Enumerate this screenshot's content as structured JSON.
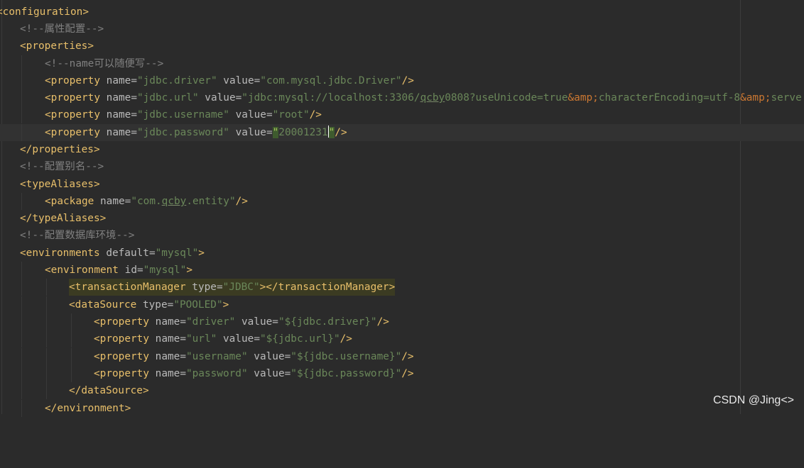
{
  "watermark": "CSDN @Jing<>",
  "lines": {
    "l1_tag": "configuration",
    "l2_cmt": "<!--属性配置-->",
    "l3_tag": "properties",
    "l4_cmt": "<!--name可以随便写-->",
    "p_tag": "property",
    "name_attr": "name",
    "value_attr": "value",
    "l5_name": "\"jdbc.driver\"",
    "l5_value": "\"com.mysql.jdbc.Driver\"",
    "l6_name": "\"jdbc.url\"",
    "l6_value_a": "\"jdbc:mysql://localhost:3306/",
    "l6_value_u": "qcby",
    "l6_value_b": "0808?useUnicode=true",
    "amp": "&amp;",
    "l6_value_c": "characterEncoding=utf-8",
    "l6_value_d": "serve",
    "l7_name": "\"jdbc.username\"",
    "l7_value": "\"root\"",
    "l8_name": "\"jdbc.password\"",
    "l8_q1": "\"",
    "l8_value": "20001231",
    "l8_q2": "\"",
    "l9_tag": "properties",
    "l10_cmt": "<!--配置别名-->",
    "l11_tag": "typeAliases",
    "l12_tag": "package",
    "l12_val_a": "\"com.",
    "l12_val_u": "qcby",
    "l12_val_b": ".entity\"",
    "l13_tag": "typeAliases",
    "l14_cmt": "<!--配置数据库环境-->",
    "l15_tag": "environments",
    "l15_attr": "default",
    "l15_val": "\"mysql\"",
    "l16_tag": "environment",
    "l16_attr": "id",
    "l16_val": "\"mysql\"",
    "l17_tag": "transactionManager",
    "l17_attr": "type",
    "l17_val": "\"JDBC\"",
    "l18_tag": "dataSource",
    "l18_attr": "type",
    "l18_val": "\"POOLED\"",
    "l19_name": "\"driver\"",
    "l19_value": "\"${jdbc.driver}\"",
    "l20_name": "\"url\"",
    "l20_value": "\"${jdbc.url}\"",
    "l21_name": "\"username\"",
    "l21_value": "\"${jdbc.username}\"",
    "l22_name": "\"password\"",
    "l22_value": "\"${jdbc.password}\"",
    "l23_tag": "dataSource",
    "l24_tag": "environment"
  }
}
